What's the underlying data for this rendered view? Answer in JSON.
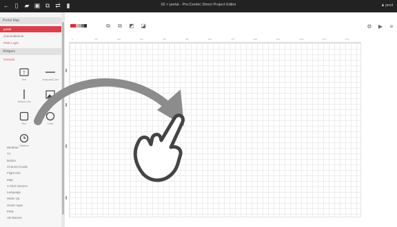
{
  "window": {
    "title": "02 > portal - Pro:Centric Direct Project Editor",
    "user": "♟ pecd",
    "icons": [
      "back-arrow-icon",
      "new-file-icon",
      "open-folder-icon",
      "save-icon",
      "export-icon",
      "transfer-icon",
      "lock-icon"
    ]
  },
  "sidebar": {
    "portal_map_header": "Portal Map",
    "pages": [
      {
        "label": "portal",
        "active": true
      },
      {
        "label": "channelbanner",
        "active": false
      },
      {
        "label": "PMS Login",
        "active": false
      }
    ],
    "widgets_header": "Widgets",
    "general_label": "General",
    "widgets": [
      {
        "label": "Text",
        "icon": "text-widget-icon"
      },
      {
        "label": "Horizontal Line",
        "icon": "horizontal-line-icon"
      },
      {
        "label": "Vertical Line",
        "icon": "vertical-line-icon"
      },
      {
        "label": "Image",
        "icon": "image-icon"
      },
      {
        "label": "Box",
        "icon": "box-icon"
      },
      {
        "label": "Circle",
        "icon": "circle-icon"
      },
      {
        "label": "Datetime",
        "icon": "clock-icon"
      }
    ],
    "categories": [
      "Weather",
      "TV",
      "Button",
      "Channel Guide",
      "Flight Info",
      "Map",
      "1-Click Service",
      "Language",
      "Wake Up",
      "Smart Apps",
      "PMS",
      "AD Banner"
    ]
  },
  "toolbar": {
    "swatch_colors": [
      "#d8303a",
      "#d8303a",
      "#f2aaaa",
      "#b0b0b0",
      "#777777",
      "#333333"
    ],
    "tool_icons": [
      "align-left-icon",
      "align-center-icon",
      "align-front-icon",
      "align-back-icon"
    ],
    "right_icons": [
      "gear-icon",
      "play-icon",
      "menu-icon"
    ]
  },
  "ruler": {
    "ticks": [
      "0",
      "100",
      "200",
      "300",
      "400",
      "500",
      "600",
      "700",
      "800",
      "900",
      "1000",
      "1100",
      "1200"
    ]
  },
  "overlay": {
    "arrow_color": "#8c8c8c",
    "hand": "pointing-hand-icon"
  }
}
